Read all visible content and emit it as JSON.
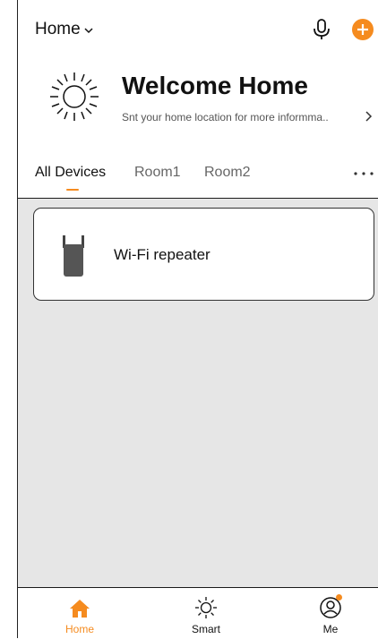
{
  "header": {
    "home_selector": "Home",
    "welcome_title": "Welcome Home",
    "location_prompt": "Snt your home location for more informma..",
    "icons": {
      "home_dropdown": "chevron-down-icon",
      "voice": "microphone-icon",
      "add": "add-circle-icon",
      "weather": "sun-icon",
      "location": "chevron-right-icon"
    }
  },
  "tabs": {
    "items": [
      {
        "label": "All Devices",
        "active": true
      },
      {
        "label": "Room1",
        "active": false
      },
      {
        "label": "Room2",
        "active": false
      }
    ],
    "more_icon": "more-dots-icon"
  },
  "devices": [
    {
      "name": "Wi-Fi repeater",
      "icon": "wifi-repeater-icon"
    }
  ],
  "tabbar": {
    "items": [
      {
        "label": "Home",
        "icon": "house-icon",
        "active": true
      },
      {
        "label": "Smart",
        "icon": "sun-icon",
        "active": false
      },
      {
        "label": "Me",
        "icon": "user-icon",
        "active": false,
        "notification_dot": true
      }
    ]
  },
  "colors": {
    "accent": "#f58b1f",
    "content_background": "#e6e6e6",
    "text": "#111111"
  }
}
